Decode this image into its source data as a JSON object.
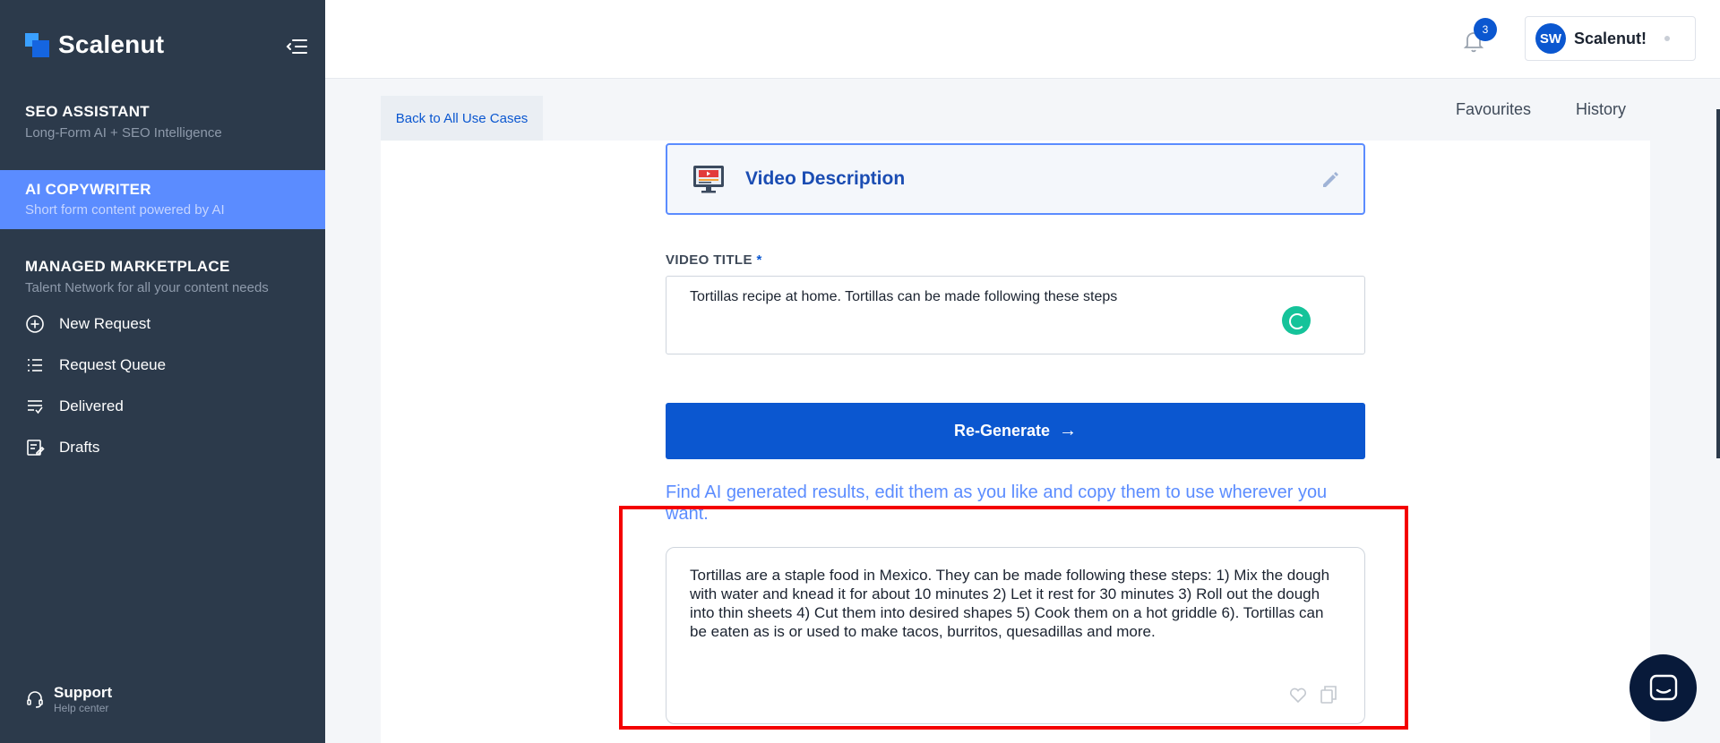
{
  "brand": {
    "name": "Scalenut"
  },
  "sidebar": {
    "sections": [
      {
        "title": "SEO ASSISTANT",
        "subtitle": "Long-Form AI + SEO Intelligence"
      },
      {
        "title": "AI COPYWRITER",
        "subtitle": "Short form content powered by AI"
      },
      {
        "title": "MANAGED MARKETPLACE",
        "subtitle": "Talent Network for all your content needs"
      }
    ],
    "items": [
      {
        "label": "New Request",
        "icon": "plus-circle-icon"
      },
      {
        "label": "Request Queue",
        "icon": "list-icon"
      },
      {
        "label": "Delivered",
        "icon": "checklist-icon"
      },
      {
        "label": "Drafts",
        "icon": "edit-note-icon"
      }
    ],
    "support": {
      "title": "Support",
      "subtitle": "Help center"
    }
  },
  "header": {
    "notification_count": "3",
    "profile": {
      "initials": "SW",
      "name": "Scalenut!"
    }
  },
  "subnav": {
    "back_label": "Back to All Use Cases",
    "favourites_label": "Favourites",
    "history_label": "History"
  },
  "main": {
    "use_case_title": "Video Description",
    "field_label": "VIDEO TITLE",
    "required_mark": "*",
    "title_value": "Tortillas recipe at home. Tortillas can be made following these steps",
    "regenerate_label": "Re-Generate",
    "hint": "Find AI generated results, edit them as you like and copy them to use wherever you want.",
    "result_text": "Tortillas are a staple food in Mexico. They can be made following these steps: 1) Mix the dough with water and knead it for about 10 minutes 2) Let it rest for 30 minutes 3) Roll out the dough into thin sheets 4) Cut them into desired shapes 5) Cook them on a hot griddle 6). Tortillas can be eaten as is or used to make tacos, burritos, quesadillas and more."
  },
  "colors": {
    "sidebar_bg": "#2c3a4b",
    "active_section": "#5b8cff",
    "primary": "#0b57d0",
    "highlight_border": "#f40000"
  }
}
